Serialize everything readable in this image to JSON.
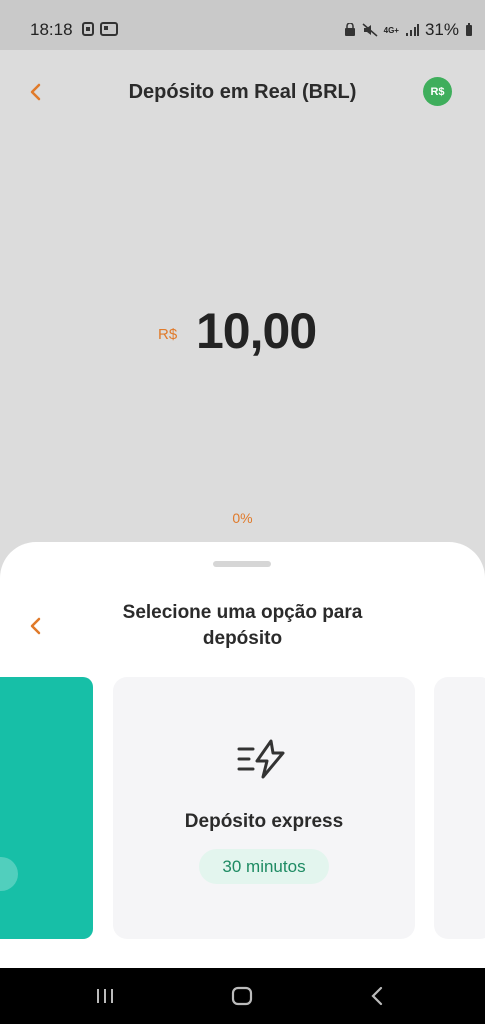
{
  "status": {
    "time": "18:18",
    "battery": "31%",
    "network": "4G+"
  },
  "header": {
    "title": "Depósito em Real (BRL)",
    "currency_badge": "R$"
  },
  "amount": {
    "currency": "R$",
    "value": "10,00",
    "percent": "0%"
  },
  "sheet": {
    "title": "Selecione uma opção para depósito",
    "card": {
      "icon": "lightning-icon",
      "title": "Depósito express",
      "chip": "30 minutos"
    }
  },
  "colors": {
    "accent": "#e07a2a",
    "teal": "#17bfa7",
    "green": "#3fae5c"
  }
}
